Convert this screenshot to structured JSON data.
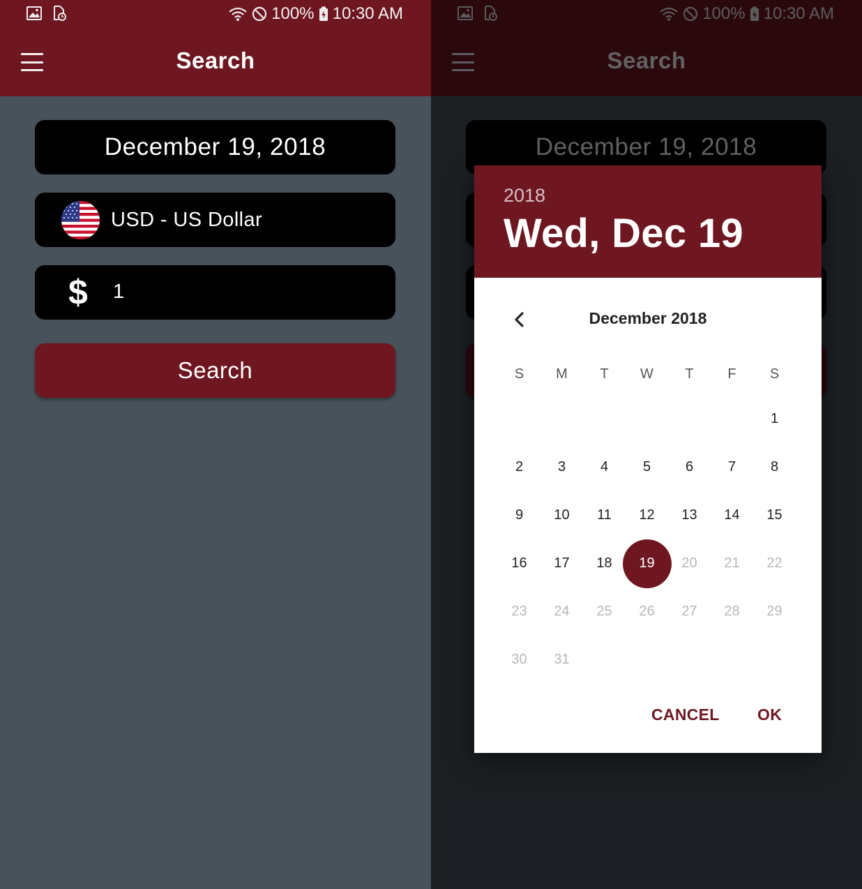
{
  "status_bar": {
    "battery": "100%",
    "time": "10:30 AM"
  },
  "app_bar": {
    "title": "Search"
  },
  "form": {
    "date": "December 19, 2018",
    "currency": "USD - US Dollar",
    "currency_symbol": "$",
    "amount": "1",
    "search_label": "Search"
  },
  "date_picker": {
    "year": "2018",
    "selected_date": "Wed, Dec 19",
    "month_label": "December 2018",
    "weekdays": [
      "S",
      "M",
      "T",
      "W",
      "T",
      "F",
      "S"
    ],
    "first_weekday_index": 6,
    "days": [
      "1",
      "2",
      "3",
      "4",
      "5",
      "6",
      "7",
      "8",
      "9",
      "10",
      "11",
      "12",
      "13",
      "14",
      "15",
      "16",
      "17",
      "18",
      "19",
      "20",
      "21",
      "22",
      "23",
      "24",
      "25",
      "26",
      "27",
      "28",
      "29",
      "30",
      "31"
    ],
    "selected_day": 19,
    "max_enabled_day": 19,
    "cancel_label": "CANCEL",
    "ok_label": "OK"
  },
  "colors": {
    "brand": "#6e1721",
    "background": "#47525b",
    "field": "#000000"
  },
  "icons": [
    "image-icon",
    "storage-sync-icon",
    "wifi-icon",
    "do-not-disturb-icon",
    "battery-charging-icon",
    "menu-icon",
    "us-flag-icon",
    "chevron-left-icon"
  ]
}
